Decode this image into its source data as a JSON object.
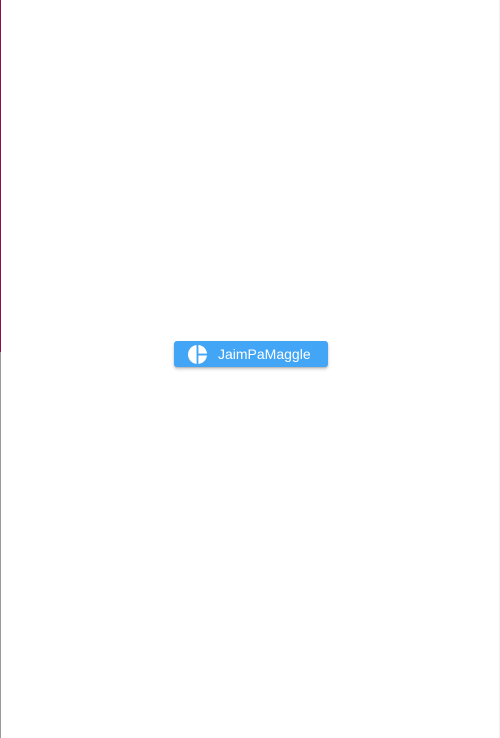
{
  "window": {
    "background_color": "#ffffff"
  },
  "primary_action": {
    "label": "JaimPaMaggle",
    "icon": "pie-chart-icon",
    "color": "#42a5f5",
    "text_color": "#ffffff"
  }
}
